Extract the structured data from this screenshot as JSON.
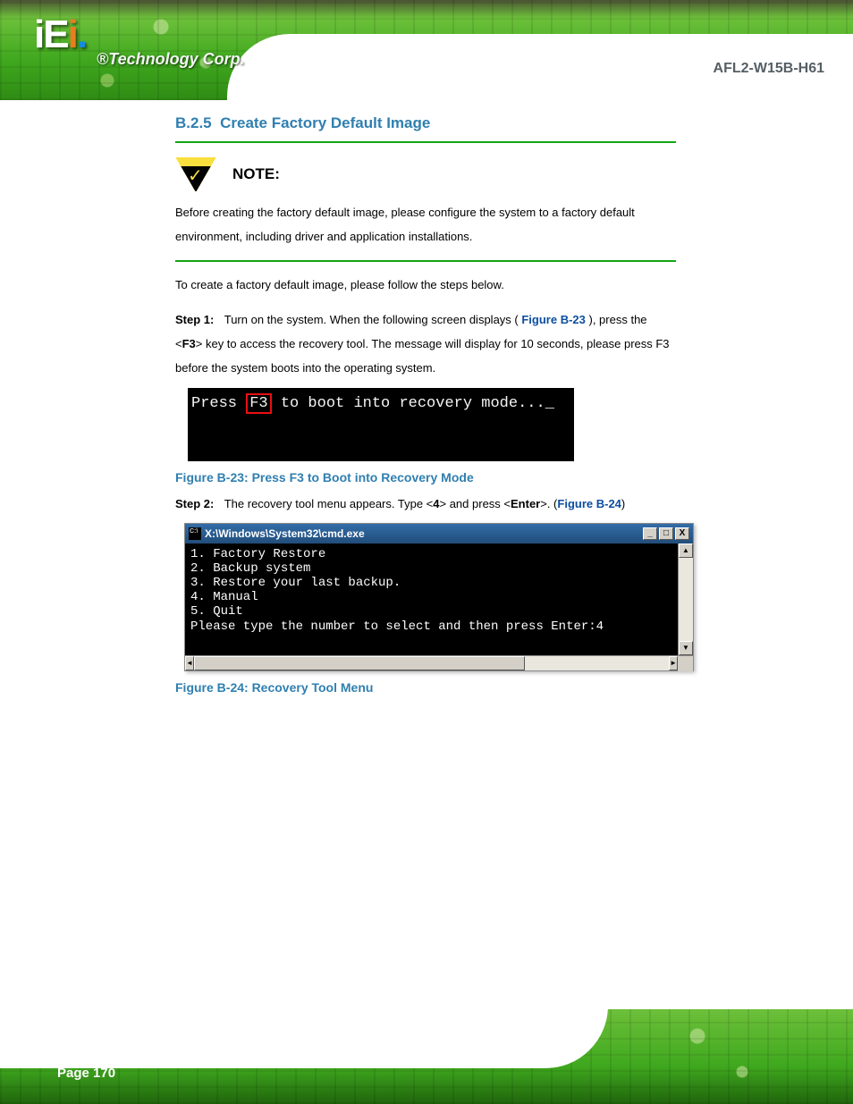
{
  "header": {
    "logo": "iEi",
    "tagline": "®Technology Corp.",
    "product": "AFL2-W15B-H61"
  },
  "section": {
    "number": "B.2.5",
    "title": "Create Factory Default Image"
  },
  "note": {
    "label": "NOTE:",
    "text": "Before creating the factory default image, please configure the system to a factory default environment, including driver and application installations."
  },
  "intro": "To create a factory default image, please follow the steps below.",
  "steps": {
    "s1": {
      "label": "Step 1:",
      "text_a": "Turn on the system. When the following screen displays (",
      "ref": "Figure B-23",
      "text_b": "), press the <",
      "key_bold": "F3",
      "text_c": "> key to access the recovery tool. The message will display for 10 seconds, please press F3 before the system boots into the operating system."
    },
    "s2": {
      "label": "Step 2:",
      "text_a": "The recovery tool menu appears. Type <",
      "key_bold": "4",
      "text_b": "> and press <",
      "key_bold2": "Enter",
      "text_c": ">. (",
      "ref": "Figure B-24",
      "text_d": ")"
    }
  },
  "terminal1": {
    "prefix": "Press",
    "key": "F3",
    "suffix": "to boot into recovery mode...",
    "cursor": "_"
  },
  "fig23_caption": "Figure B-23: Press F3 to Boot into Recovery Mode",
  "cmdwin": {
    "title": "X:\\Windows\\System32\\cmd.exe",
    "btn_min": "_",
    "btn_max": "□",
    "btn_close": "X",
    "lines": {
      "l1": "1. Factory Restore",
      "l2": "2. Backup system",
      "l3": "3. Restore your last backup.",
      "l4": "4. Manual",
      "l5": "5. Quit",
      "prompt": "Please type the number to select and then press Enter:4"
    },
    "arrow_up": "▲",
    "arrow_down": "▼",
    "arrow_left": "◄",
    "arrow_right": "►"
  },
  "fig24_caption": "Figure B-24: Recovery Tool Menu",
  "footer": {
    "page": "Page 170"
  }
}
